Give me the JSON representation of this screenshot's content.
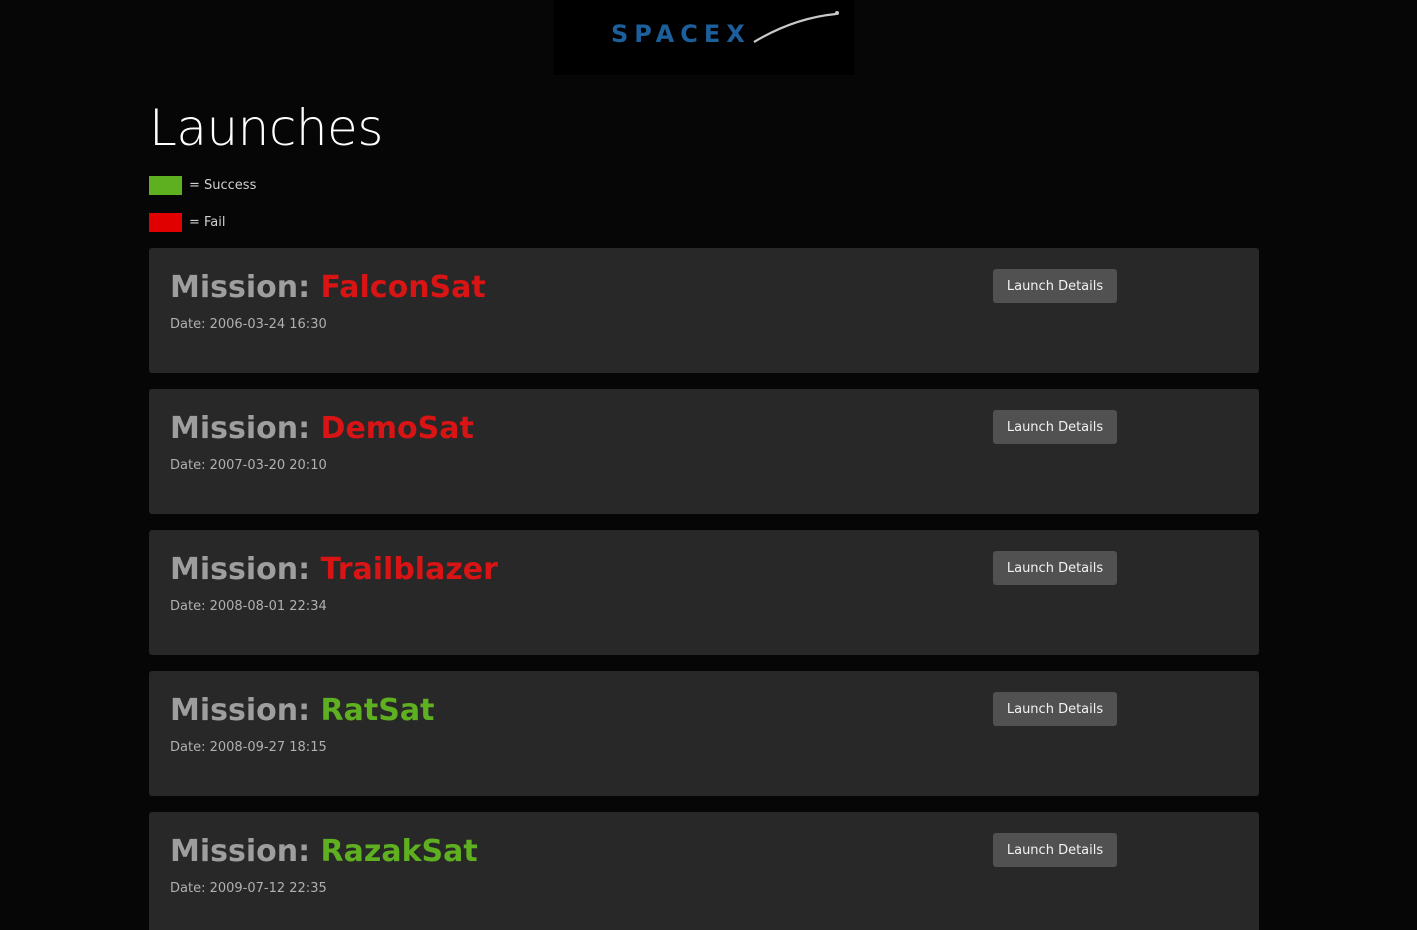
{
  "header": {
    "logo_text": "SPACEX"
  },
  "page": {
    "title": "Launches"
  },
  "legend": [
    {
      "label": "= Success",
      "color": "#5eb020"
    },
    {
      "label": "= Fail",
      "color": "#e00000"
    }
  ],
  "launches": [
    {
      "prefix": "Mission: ",
      "name": "FalconSat",
      "status": "fail",
      "date": "Date: 2006-03-24 16:30",
      "button_label": "Launch Details"
    },
    {
      "prefix": "Mission: ",
      "name": "DemoSat",
      "status": "fail",
      "date": "Date: 2007-03-20 20:10",
      "button_label": "Launch Details"
    },
    {
      "prefix": "Mission: ",
      "name": "Trailblazer",
      "status": "fail",
      "date": "Date: 2008-08-01 22:34",
      "button_label": "Launch Details"
    },
    {
      "prefix": "Mission: ",
      "name": "RatSat",
      "status": "success",
      "date": "Date: 2008-09-27 18:15",
      "button_label": "Launch Details"
    },
    {
      "prefix": "Mission: ",
      "name": "RazakSat",
      "status": "success",
      "date": "Date: 2009-07-12 22:35",
      "button_label": "Launch Details"
    }
  ],
  "colors": {
    "background": "#060606",
    "card": "#282828",
    "success": "#5eb020",
    "fail": "#d91414",
    "logo_blue": "#1d5f9a"
  }
}
